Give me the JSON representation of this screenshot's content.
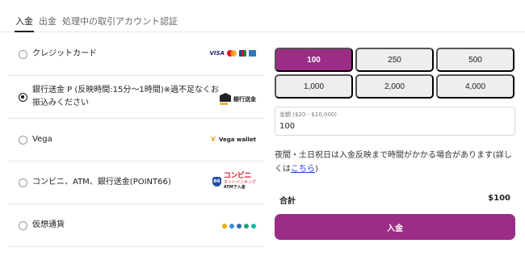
{
  "tabs": [
    {
      "label": "入金",
      "active": true
    },
    {
      "label": "出金",
      "active": false
    },
    {
      "label": "処理中の取引",
      "active": false
    },
    {
      "label": "アカウント認証",
      "active": false
    }
  ],
  "methods": [
    {
      "label": "クレジットカード",
      "selected": false,
      "logo": {
        "visa": "VISA"
      }
    },
    {
      "label_line1": "銀行送金 P (反映時間:15分〜1時間)※過不足なくお",
      "label_line2": "振込みください",
      "selected": true,
      "logo": {
        "text": "銀行送金"
      }
    },
    {
      "label": "Vega",
      "selected": false,
      "logo": {
        "text": "Vega wallet"
      }
    },
    {
      "label": "コンビニ、ATM、銀行送金(POINT66)",
      "selected": false,
      "logo": {
        "badge": "66",
        "top": "コンビニ",
        "mid": "ネットバンキング",
        "bottom": "ATMで入金"
      }
    },
    {
      "label": "仮想通貨",
      "selected": false,
      "logo": {
        "coins": [
          "#f2a900",
          "#3c8dd9",
          "#2b6cb0",
          "#26a17b",
          "#14b8a6"
        ]
      }
    }
  ],
  "amounts": [
    {
      "label": "100",
      "selected": true
    },
    {
      "label": "250",
      "selected": false
    },
    {
      "label": "500",
      "selected": false
    },
    {
      "label": "1,000",
      "selected": false
    },
    {
      "label": "2,000",
      "selected": false
    },
    {
      "label": "4,000",
      "selected": false
    }
  ],
  "amount_field": {
    "label": "金額 ($20 - $10,000)",
    "value": "100"
  },
  "note": {
    "text": "夜間・土日祝日は入金反映まで時間がかかる場合があります(詳しくは",
    "link": "こちら",
    "tail": ")"
  },
  "summary": {
    "total_label": "合計",
    "total_value": "$100"
  },
  "deposit_button": "入金",
  "colors": {
    "accent": "#9b2d86",
    "link": "#1a3fd4"
  }
}
